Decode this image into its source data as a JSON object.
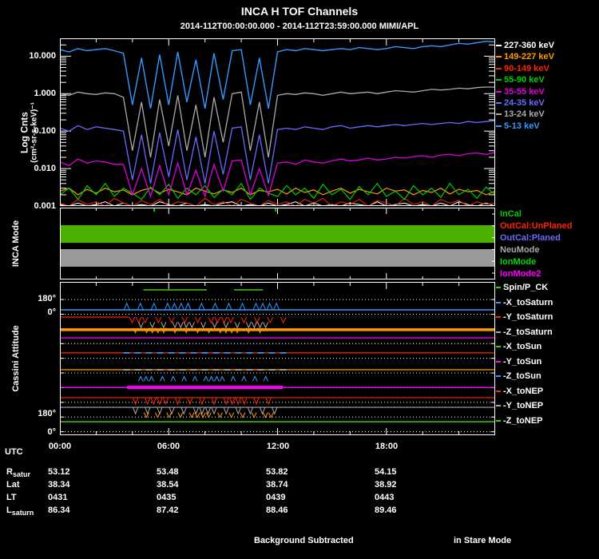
{
  "header": {
    "title": "INCA H TOF Channels",
    "subtitle": "2014-112T00:00:00.000 - 2014-112T23:59:00.000 MIMI/APL"
  },
  "top_panel": {
    "ylabel_line1": "Log Cnts",
    "ylabel_line2": "(cm²-sr-s-keV)⁻¹",
    "yticks": [
      "10.000",
      "1.000",
      "0.100",
      "0.010",
      "0.001"
    ],
    "legend": [
      {
        "label": "227-360 keV",
        "color": "#FFFFFF"
      },
      {
        "label": "149-227 keV",
        "color": "#FF9900"
      },
      {
        "label": "90-149 keV",
        "color": "#FF2200"
      },
      {
        "label": "55-90 keV",
        "color": "#00CC00"
      },
      {
        "label": "35-55 keV",
        "color": "#DD00DD"
      },
      {
        "label": "24-35 keV",
        "color": "#6A6AFF"
      },
      {
        "label": "13-24 keV",
        "color": "#AAAAAA"
      },
      {
        "label": "5-13 keV",
        "color": "#3399FF"
      }
    ]
  },
  "mode_panel": {
    "ylabel": "INCA Mode",
    "legend": [
      {
        "label": "InCal",
        "color": "#00CC00"
      },
      {
        "label": "OutCal:UnPlaned",
        "color": "#FF2200"
      },
      {
        "label": "OutCal:Planed",
        "color": "#6A6AFF"
      },
      {
        "label": "NeuMode",
        "color": "#AAAAAA"
      },
      {
        "label": "IonMode",
        "color": "#00DD00"
      },
      {
        "label": "IonMode2",
        "color": "#FF00FF"
      }
    ]
  },
  "attitude_panel": {
    "ylabel": "Cassini Attitude",
    "yticks": [
      "180°",
      "0°",
      "180°",
      "0°"
    ],
    "labels": [
      {
        "label": "Spin/P_CK",
        "tick": "#44CC00"
      },
      {
        "label": "-X_toSaturn",
        "tick": "#3399FF"
      },
      {
        "label": "-Y_toSaturn",
        "tick": "#FF2200"
      },
      {
        "label": "-Z_toSaturn",
        "tick": "#AAAAAA"
      },
      {
        "label": "-X_toSun",
        "tick": "#44CC00"
      },
      {
        "label": "-Y_toSun",
        "tick": "#FF00FF"
      },
      {
        "label": "-Z_toSun",
        "tick": "#3399FF"
      },
      {
        "label": "-X_toNEP",
        "tick": "#FF2200"
      },
      {
        "label": "-Y_toNEP",
        "tick": "#AAAAAA"
      },
      {
        "label": "-Z_toNEP",
        "tick": "#44CC00"
      }
    ]
  },
  "xaxis": {
    "label": "UTC",
    "ticks": [
      "00:00",
      "06:00",
      "12:00",
      "18:00"
    ]
  },
  "table": {
    "rows": [
      {
        "label": "R",
        "sub": "satur",
        "values": [
          "53.12",
          "53.48",
          "53.82",
          "54.15"
        ]
      },
      {
        "label": "Lat",
        "sub": "",
        "values": [
          "38.34",
          "38.54",
          "38.74",
          "38.92"
        ]
      },
      {
        "label": "LT",
        "sub": "",
        "values": [
          "0431",
          "0435",
          "0439",
          "0443"
        ]
      },
      {
        "label": "L",
        "sub": "saturn",
        "values": [
          "86.34",
          "87.42",
          "88.46",
          "89.46"
        ]
      }
    ]
  },
  "footer": {
    "left": "Background Subtracted",
    "right": "in Stare Mode"
  },
  "chart_data": [
    {
      "type": "line",
      "title": "INCA H TOF Channels",
      "time_range": "2014-112T00:00:00.000 - 2014-112T23:59:00.000",
      "xlabel": "UTC",
      "ylabel": "Log Cnts (cm²-sr-s-keV)⁻¹",
      "yscale": "log",
      "ylim": [
        0.001,
        30
      ],
      "yticks": [
        10,
        1,
        0.1,
        0.01,
        0.001
      ],
      "x_start_h": 0,
      "x_step_h": 0.5,
      "series": [
        {
          "name": "227-360 keV",
          "color": "#FFFFFF",
          "width": 1,
          "values": [
            0.0011,
            0.001,
            0.0012,
            0.001,
            0.0011,
            0.0013,
            0.001,
            0.0012,
            0.001,
            0.0011,
            0.001,
            0.0013,
            0.0011,
            0.001,
            0.0012,
            0.001,
            0.0011,
            0.001,
            0.0012,
            0.0013,
            0.001,
            0.0011,
            0.001,
            0.0012,
            0.001,
            0.0011,
            0.0013,
            0.001,
            0.0012,
            0.001,
            0.0011,
            0.001,
            0.0012,
            0.0011,
            0.001,
            0.0013,
            0.001,
            0.0011,
            0.0012,
            0.001,
            0.0011,
            0.001,
            0.0012,
            0.001,
            0.0013,
            0.0011,
            0.001,
            0.0012,
            0.001
          ]
        },
        {
          "name": "90-149 keV",
          "color": "#FF2200",
          "width": 1,
          "values": [
            0.0012,
            0.001,
            0.0015,
            0.0011,
            0.0013,
            0.001,
            0.0016,
            0.0012,
            0.001,
            0.0014,
            0.0011,
            0.0015,
            0.001,
            0.0013,
            0.0012,
            0.001,
            0.0016,
            0.0011,
            0.0013,
            0.001,
            0.0015,
            0.0012,
            0.001,
            0.0014,
            0.0011,
            0.0013,
            0.001,
            0.0015,
            0.0012,
            0.0016,
            0.001,
            0.0013,
            0.0011,
            0.0015,
            0.001,
            0.0014,
            0.0012,
            0.001,
            0.0016,
            0.0011,
            0.0013,
            0.001,
            0.0015,
            0.0012,
            0.0014,
            0.001,
            0.0013,
            0.0011,
            0.0012
          ]
        },
        {
          "name": "149-227 keV",
          "color": "#FF9900",
          "width": 1.2,
          "values": [
            0.0025,
            0.003,
            0.002,
            0.0028,
            0.0022,
            0.003,
            0.0024,
            0.0027,
            0.002,
            0.0026,
            0.003,
            0.0022,
            0.0028,
            0.0024,
            0.002,
            0.003,
            0.0025,
            0.0021,
            0.0027,
            0.0023,
            0.003,
            0.002,
            0.0026,
            0.0024,
            0.0028,
            0.0021,
            0.003,
            0.0023,
            0.0027,
            0.002,
            0.0025,
            0.003,
            0.0022,
            0.0028,
            0.0024,
            0.0021,
            0.003,
            0.0025,
            0.0027,
            0.002,
            0.0026,
            0.0023,
            0.003,
            0.0021,
            0.0028,
            0.0024,
            0.0026,
            0.002,
            0.0025
          ]
        },
        {
          "name": "55-90 keV",
          "color": "#00CC00",
          "width": 1.2,
          "values": [
            0.002,
            0.003,
            0.0015,
            0.0035,
            0.002,
            0.004,
            0.0018,
            0.003,
            0.0022,
            0.0015,
            0.0032,
            0.002,
            0.0038,
            0.0016,
            0.003,
            0.002,
            0.0035,
            0.0017,
            0.0028,
            0.002,
            0.004,
            0.0015,
            0.003,
            0.0022,
            0.0018,
            0.0035,
            0.002,
            0.003,
            0.0016,
            0.0038,
            0.002,
            0.0028,
            0.0015,
            0.0033,
            0.002,
            0.004,
            0.0018,
            0.0025,
            0.0015,
            0.0035,
            0.002,
            0.003,
            0.0017,
            0.004,
            0.002,
            0.0028,
            0.0016,
            0.0032,
            0.002
          ]
        },
        {
          "name": "35-55 keV",
          "color": "#DD00DD",
          "width": 1.3,
          "values": [
            0.015,
            0.012,
            0.018,
            0.014,
            0.016,
            0.015,
            0.013,
            0.013,
            0.002,
            0.01,
            0.0018,
            0.012,
            0.002,
            0.014,
            0.002,
            0.009,
            0.0018,
            0.013,
            0.0025,
            0.016,
            0.017,
            0.002,
            0.01,
            0.0019,
            0.014,
            0.015,
            0.013,
            0.017,
            0.015,
            0.014,
            0.016,
            0.018,
            0.016,
            0.017,
            0.019,
            0.017,
            0.018,
            0.02,
            0.019,
            0.021,
            0.022,
            0.02,
            0.023,
            0.024,
            0.022,
            0.025,
            0.026,
            0.024,
            0.027
          ]
        },
        {
          "name": "24-35 keV",
          "color": "#6A6AFF",
          "width": 1.3,
          "values": [
            0.12,
            0.1,
            0.14,
            0.11,
            0.13,
            0.12,
            0.11,
            0.1,
            0.005,
            0.08,
            0.004,
            0.09,
            0.006,
            0.11,
            0.005,
            0.07,
            0.004,
            0.1,
            0.007,
            0.12,
            0.13,
            0.005,
            0.08,
            0.004,
            0.11,
            0.12,
            0.11,
            0.13,
            0.12,
            0.11,
            0.13,
            0.14,
            0.12,
            0.13,
            0.14,
            0.13,
            0.14,
            0.15,
            0.14,
            0.15,
            0.16,
            0.15,
            0.16,
            0.17,
            0.16,
            0.18,
            0.17,
            0.18,
            0.19
          ]
        },
        {
          "name": "13-24 keV",
          "color": "#AAAAAA",
          "width": 1.3,
          "values": [
            1.0,
            0.9,
            1.1,
            1.0,
            0.95,
            1.05,
            1.0,
            0.8,
            0.03,
            0.6,
            0.02,
            0.7,
            0.04,
            0.9,
            0.03,
            0.5,
            0.02,
            0.8,
            0.05,
            1.0,
            1.1,
            0.03,
            0.6,
            0.02,
            0.9,
            1.0,
            0.95,
            1.05,
            1.0,
            0.9,
            1.0,
            1.1,
            1.0,
            1.05,
            1.1,
            1.0,
            1.1,
            1.2,
            1.15,
            1.1,
            1.2,
            1.3,
            1.25,
            1.3,
            1.4,
            1.35,
            1.45,
            1.5,
            1.5
          ]
        },
        {
          "name": "5-13 keV",
          "color": "#3399FF",
          "width": 1.4,
          "values": [
            15,
            13,
            16,
            14,
            15,
            16,
            14,
            12,
            0.5,
            9,
            0.4,
            11,
            0.5,
            13,
            0.6,
            8,
            0.4,
            12,
            0.7,
            14,
            15,
            0.5,
            9,
            0.4,
            13,
            15,
            14,
            16,
            15,
            14,
            15,
            16,
            15,
            17,
            16,
            15,
            16,
            18,
            17,
            16,
            18,
            19,
            18,
            20,
            22,
            21,
            23,
            25,
            24
          ]
        }
      ]
    },
    {
      "type": "timeline",
      "label": "INCA Mode",
      "modes": [
        "InCal",
        "OutCal:UnPlaned",
        "OutCal:Planed",
        "NeuMode",
        "IonMode",
        "IonMode2"
      ],
      "bars": [
        {
          "name": "green-mode-bar",
          "color": "#4CB000",
          "start_h": 0,
          "end_h": 24,
          "top_frac": 0.244,
          "bottom_frac": 0.489
        },
        {
          "name": "gray-mode-bar",
          "color": "#999999",
          "start_h": 0,
          "end_h": 24,
          "top_frac": 0.578,
          "bottom_frac": 0.822
        }
      ],
      "event_ticks_h": [
        5.2,
        11.9
      ]
    },
    {
      "type": "line",
      "label": "Cassini Attitude",
      "ylim_deg": [
        0,
        180
      ],
      "yticks": [
        "180°",
        "0°",
        "180°",
        "0°"
      ],
      "disturbance_window_h": [
        3.5,
        12.5
      ],
      "series": [
        {
          "name": "Spin/P_CK",
          "color": "#44CC00",
          "width": 1.5,
          "y_frac": 0.052,
          "segments": [
            [
              4.6,
              8.1
            ],
            [
              9.6,
              11.2
            ]
          ]
        },
        {
          "name": "-X_toSaturn",
          "color": "#3399FF",
          "width": 1.5,
          "y_frac": 0.182,
          "segments": [
            [
              0,
              24
            ]
          ],
          "caret": {
            "window": [
              3.5,
              12.5
            ],
            "amp": 8,
            "dir": -1
          }
        },
        {
          "name": "-Y_toSaturn",
          "color": "#FF2200",
          "width": 1.3,
          "y_frac": 0.229,
          "segments": [
            [
              0,
              3.8
            ]
          ],
          "caret": {
            "window": [
              3.8,
              12.5
            ],
            "amp": 7,
            "dir": 1
          }
        },
        {
          "name": "-Z_toSaturn",
          "color": "#FF9900",
          "width": 3.5,
          "y_frac": 0.312,
          "segments": [
            [
              0,
              24
            ]
          ]
        },
        {
          "name": "-X_toSun",
          "color": "#CC00CC",
          "width": 1.6,
          "y_frac": 0.365,
          "segments": [
            [
              0,
              24
            ]
          ]
        },
        {
          "name": "-Y_toSun",
          "color": "#FF2200",
          "width": 1.2,
          "y_frac": 0.463,
          "segments": [
            [
              0,
              24
            ]
          ],
          "dash_overlay": {
            "color": "#3399FF",
            "window": [
              3.5,
              12.5
            ]
          }
        },
        {
          "name": "-Z_toSun",
          "color": "#FF9900",
          "width": 1.2,
          "y_frac": 0.573,
          "segments": [
            [
              0,
              24
            ]
          ],
          "dash_overlay": {
            "color": "#AAAAAA",
            "window": [
              3.5,
              12.5
            ]
          }
        },
        {
          "name": "-X_toNEP",
          "color": "#FF00FF",
          "width": 1.2,
          "y_frac": 0.688,
          "segments": [
            [
              0,
              24
            ]
          ],
          "thick_overlay": {
            "window": [
              3.7,
              12.3
            ],
            "width": 4
          }
        },
        {
          "name": "-Y_toNEP",
          "color": "#FF2200",
          "width": 1.2,
          "y_frac": 0.755,
          "segments": [
            [
              0,
              24
            ]
          ],
          "caret": {
            "window": [
              4,
              12
            ],
            "amp": 8,
            "dir": 1
          }
        },
        {
          "name": "-Z_toNEP",
          "color": "#AAAAAA",
          "width": 1.2,
          "y_frac": 0.818,
          "segments": [
            [
              0,
              24
            ]
          ],
          "caret": {
            "window": [
              4,
              12
            ],
            "amp": 8,
            "dir": 1
          }
        },
        {
          "name": "unlabeled-green-line",
          "color": "#44CC00",
          "width": 1.5,
          "y_frac": 0.912,
          "segments": [
            [
              0,
              24
            ]
          ]
        }
      ],
      "caret_clusters": [
        {
          "color": "#AAAAAA",
          "y_frac": 0.262,
          "window": [
            4,
            11.5
          ],
          "amp": 7,
          "dir": 1
        },
        {
          "color": "#FF9900",
          "y_frac": 0.3,
          "window": [
            4,
            11.5
          ],
          "amp": 6,
          "dir": 1
        },
        {
          "color": "#3399FF",
          "y_frac": 0.648,
          "window": [
            4.3,
            11.5
          ],
          "amp": 6,
          "dir": -1
        },
        {
          "color": "#FF9900",
          "y_frac": 0.852,
          "window": [
            4.3,
            11.8
          ],
          "amp": 6,
          "dir": 1
        }
      ]
    }
  ]
}
